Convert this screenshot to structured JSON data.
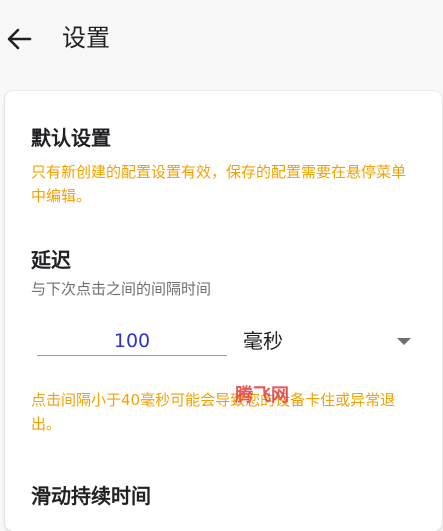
{
  "header": {
    "title": "设置"
  },
  "default_settings": {
    "title": "默认设置",
    "note": "只有新创建的配置设置有效，保存的配置需要在悬停菜单中编辑。"
  },
  "delay": {
    "title": "延迟",
    "description": "与下次点击之间的间隔时间",
    "value": "100",
    "unit_selected": "毫秒",
    "warning": "点击间隔小于40毫秒可能会导致您的设备卡住或异常退出。"
  },
  "swipe_duration": {
    "title": "滑动持续时间"
  },
  "watermark": {
    "text": "腾飞网"
  },
  "colors": {
    "warning_text": "#f2a200",
    "input_value": "#2b35c8"
  }
}
